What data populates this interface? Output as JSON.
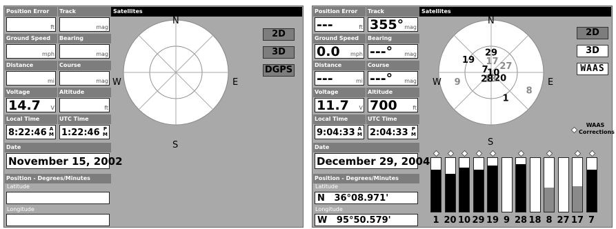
{
  "screens": [
    {
      "fields": {
        "position_error": {
          "label": "Position Error",
          "value": "",
          "unit": "ft"
        },
        "track": {
          "label": "Track",
          "value": "",
          "unit": "mag"
        },
        "ground_speed": {
          "label": "Ground Speed",
          "value": "",
          "unit": "mph"
        },
        "bearing": {
          "label": "Bearing",
          "value": "",
          "unit": "mag"
        },
        "distance": {
          "label": "Distance",
          "value": "",
          "unit": "mi"
        },
        "course": {
          "label": "Course",
          "value": "",
          "unit": "mag"
        },
        "voltage": {
          "label": "Voltage",
          "value": "14.7",
          "unit": "V"
        },
        "altitude": {
          "label": "Altitude",
          "value": "",
          "unit": "ft"
        },
        "local_time": {
          "label": "Local Time",
          "value": "8:22:46",
          "ampm": "A M"
        },
        "utc_time": {
          "label": "UTC Time",
          "value": "1:22:46",
          "ampm": "P M"
        },
        "date": {
          "label": "Date",
          "value": "November 15, 2002"
        }
      },
      "position": {
        "label": "Position - Degrees/Minutes",
        "latitude_label": "Latitude",
        "latitude": "",
        "longitude_label": "Longitude",
        "longitude": ""
      },
      "satellites": {
        "header": "Satellites",
        "compass": {
          "n": "N",
          "s": "S",
          "e": "E",
          "w": "W"
        },
        "modes": [
          "2D",
          "3D",
          "DGPS"
        ],
        "active_mode": "2D"
      }
    },
    {
      "fields": {
        "position_error": {
          "label": "Position Error",
          "value": "---",
          "unit": "ft"
        },
        "track": {
          "label": "Track",
          "value": "355°",
          "unit": "mag"
        },
        "ground_speed": {
          "label": "Ground Speed",
          "value": "0.0",
          "unit": "mph"
        },
        "bearing": {
          "label": "Bearing",
          "value": "---°",
          "unit": "mag"
        },
        "distance": {
          "label": "Distance",
          "value": "---",
          "unit": "mi"
        },
        "course": {
          "label": "Course",
          "value": "---°",
          "unit": "mag"
        },
        "voltage": {
          "label": "Voltage",
          "value": "11.7",
          "unit": "V"
        },
        "altitude": {
          "label": "Altitude",
          "value": "700",
          "unit": "ft"
        },
        "local_time": {
          "label": "Local Time",
          "value": "9:04:33",
          "ampm": "A M"
        },
        "utc_time": {
          "label": "UTC Time",
          "value": "2:04:33",
          "ampm": "P M"
        },
        "date": {
          "label": "Date",
          "value": "December 29, 2004"
        }
      },
      "position": {
        "label": "Position - Degrees/Minutes",
        "latitude_label": "Latitude",
        "latitude": "N   36°08.971'",
        "longitude_label": "Longitude",
        "longitude": "W   95°50.579'"
      },
      "satellites": {
        "header": "Satellites",
        "compass": {
          "n": "N",
          "s": "S",
          "e": "E",
          "w": "W"
        },
        "modes": [
          "2D",
          "3D",
          "WAAS"
        ],
        "active_mode": "3D",
        "waas_legend": "WAAS Corrections",
        "sky": [
          {
            "prn": "29",
            "az": 0,
            "el": 55,
            "used": true
          },
          {
            "prn": "19",
            "az": 300,
            "el": 45,
            "used": true
          },
          {
            "prn": "17",
            "az": 5,
            "el": 70,
            "used": false
          },
          {
            "prn": "27",
            "az": 65,
            "el": 62,
            "used": false
          },
          {
            "prn": "7",
            "az": 300,
            "el": 78,
            "used": true
          },
          {
            "prn": "10",
            "az": 80,
            "el": 86,
            "used": true
          },
          {
            "prn": "9",
            "az": 255,
            "el": 30,
            "used": false
          },
          {
            "prn": "20",
            "az": 120,
            "el": 72,
            "used": true
          },
          {
            "prn": "18",
            "az": 190,
            "el": 80,
            "used": false
          },
          {
            "prn": "28",
            "az": 215,
            "el": 78,
            "used": true
          },
          {
            "prn": "8",
            "az": 115,
            "el": 18,
            "used": false
          },
          {
            "prn": "1",
            "az": 150,
            "el": 40,
            "used": true
          }
        ],
        "bars": [
          {
            "prn": "1",
            "level": 0.78,
            "used": true,
            "waas": true
          },
          {
            "prn": "20",
            "level": 0.7,
            "used": true,
            "waas": true
          },
          {
            "prn": "10",
            "level": 0.82,
            "used": true,
            "waas": true
          },
          {
            "prn": "29",
            "level": 0.78,
            "used": true,
            "waas": true
          },
          {
            "prn": "19",
            "level": 0.86,
            "used": true,
            "waas": true
          },
          {
            "prn": "9",
            "level": 0.0,
            "used": false,
            "waas": false
          },
          {
            "prn": "28",
            "level": 0.88,
            "used": true,
            "waas": true
          },
          {
            "prn": "18",
            "level": 0.0,
            "used": false,
            "waas": false
          },
          {
            "prn": "8",
            "level": 0.45,
            "used": false,
            "waas": true
          },
          {
            "prn": "27",
            "level": 0.0,
            "used": false,
            "waas": false
          },
          {
            "prn": "17",
            "level": 0.47,
            "used": false,
            "waas": true
          },
          {
            "prn": "7",
            "level": 0.78,
            "used": true,
            "waas": true
          }
        ]
      }
    }
  ]
}
